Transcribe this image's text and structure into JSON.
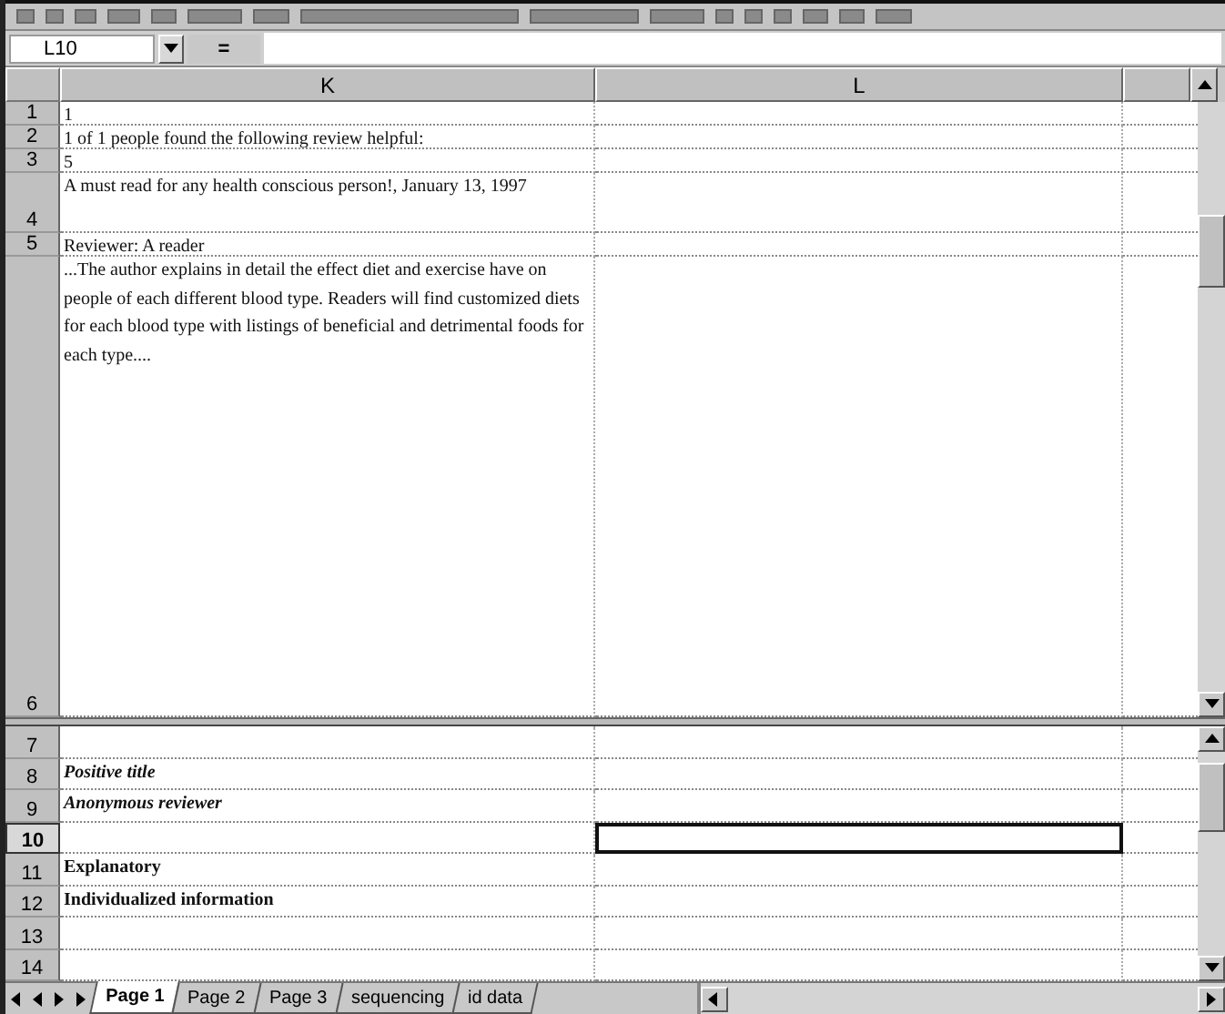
{
  "name_box": {
    "value": "L10"
  },
  "formula_bar": {
    "equals": "="
  },
  "columns": [
    "K",
    "L"
  ],
  "top_pane": {
    "rows": [
      {
        "number": "1",
        "text": "1",
        "kind": "plain",
        "selected": false
      },
      {
        "number": "2",
        "text": "1 of 1 people found the following review helpful:",
        "kind": "plain",
        "selected": false
      },
      {
        "number": "3",
        "text": "5",
        "kind": "plain",
        "selected": false
      },
      {
        "number": "4",
        "text": "A must read for any health conscious person!, January 13, 1997",
        "kind": "plain",
        "selected": false
      },
      {
        "number": "5",
        "text": "Reviewer: A reader",
        "kind": "plain",
        "selected": false
      },
      {
        "number": "6",
        "text": "...The author explains in detail the effect diet and exercise have on people of each different blood type. Readers will find customized diets for each blood type with listings of beneficial and detrimental foods for each type....",
        "kind": "plain",
        "selected": false
      }
    ]
  },
  "bottom_pane": {
    "rows": [
      {
        "number": "7",
        "kind": "plain",
        "selected": false
      },
      {
        "number": "8",
        "text": "Positive title",
        "kind": "bold-italic",
        "selected": false
      },
      {
        "number": "9",
        "text": "Anonymous reviewer",
        "kind": "bold-italic",
        "selected": false
      },
      {
        "number": "10",
        "kind": "plain",
        "selected": true
      },
      {
        "number": "11",
        "text": "Explanatory",
        "kind": "bold",
        "selected": false
      },
      {
        "number": "12",
        "text": "Individualized information",
        "kind": "bold",
        "selected": false
      },
      {
        "number": "13",
        "kind": "plain",
        "selected": false
      },
      {
        "number": "14",
        "kind": "plain",
        "selected": false
      }
    ]
  },
  "sheet_tabs": [
    {
      "label": "Page 1",
      "selected": true
    },
    {
      "label": "Page 2",
      "selected": false
    },
    {
      "label": "Page 3",
      "selected": false
    },
    {
      "label": "sequencing",
      "selected": false
    },
    {
      "label": "id data",
      "selected": false
    }
  ]
}
